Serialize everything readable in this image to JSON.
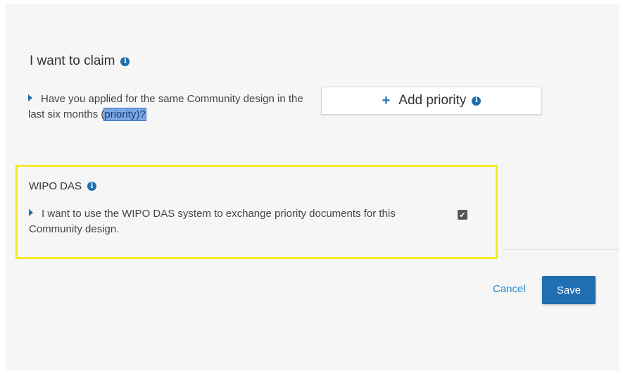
{
  "claim": {
    "heading": "I want to claim",
    "question_text": "Have you applied for the same Community design in the last six months (",
    "question_highlight": "priority)?",
    "add_priority_label": "Add priority"
  },
  "wipo": {
    "title": "WIPO DAS",
    "text": "I want to use the WIPO DAS system to exchange priority documents for this Community design.",
    "checked": true
  },
  "actions": {
    "cancel_label": "Cancel",
    "save_label": "Save"
  },
  "colors": {
    "accent": "#1f6fb2",
    "highlight_border": "#f2ea2a"
  },
  "icons": {
    "info": "info-icon",
    "plus": "plus-icon",
    "caret": "caret-right-icon",
    "check": "check-icon"
  }
}
